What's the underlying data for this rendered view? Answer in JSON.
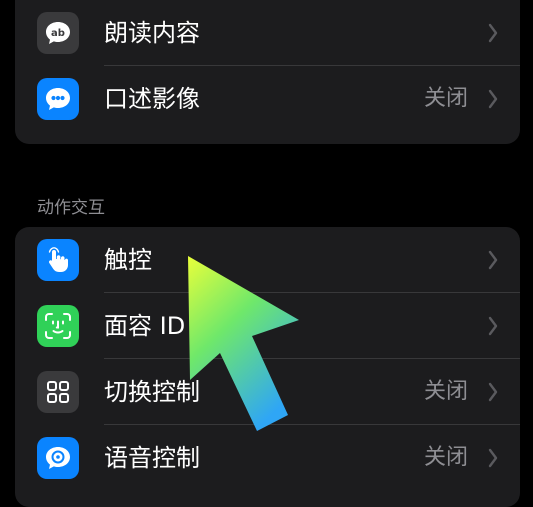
{
  "groups": {
    "top": [
      {
        "label": "朗读内容",
        "value": "",
        "icon": "speech-bubble-text-icon",
        "icon_bg": "#3a3a3c"
      },
      {
        "label": "口述影像",
        "value": "关闭",
        "icon": "audio-description-icon",
        "icon_bg": "#0a84ff"
      }
    ],
    "motion": {
      "header": "动作交互",
      "rows": [
        {
          "label": "触控",
          "value": "",
          "icon": "hand-touch-icon",
          "icon_bg": "#0a84ff"
        },
        {
          "label": "面容 ID",
          "value": "",
          "icon": "face-id-icon",
          "icon_bg": "#30d158"
        },
        {
          "label": "切换控制",
          "value": "关闭",
          "icon": "switch-control-icon",
          "icon_bg": "#3a3a3c"
        },
        {
          "label": "语音控制",
          "value": "关闭",
          "icon": "voice-control-icon",
          "icon_bg": "#0a84ff"
        }
      ]
    }
  },
  "colors": {
    "background": "#000000",
    "group_bg": "#1c1c1e",
    "separator": "#38383a",
    "secondary_text": "#8e8e93",
    "arrow_gradient_start": "#e9ff3a",
    "arrow_gradient_end": "#2fa6f5"
  },
  "overlay": {
    "icon": "pointer-arrow-icon"
  }
}
